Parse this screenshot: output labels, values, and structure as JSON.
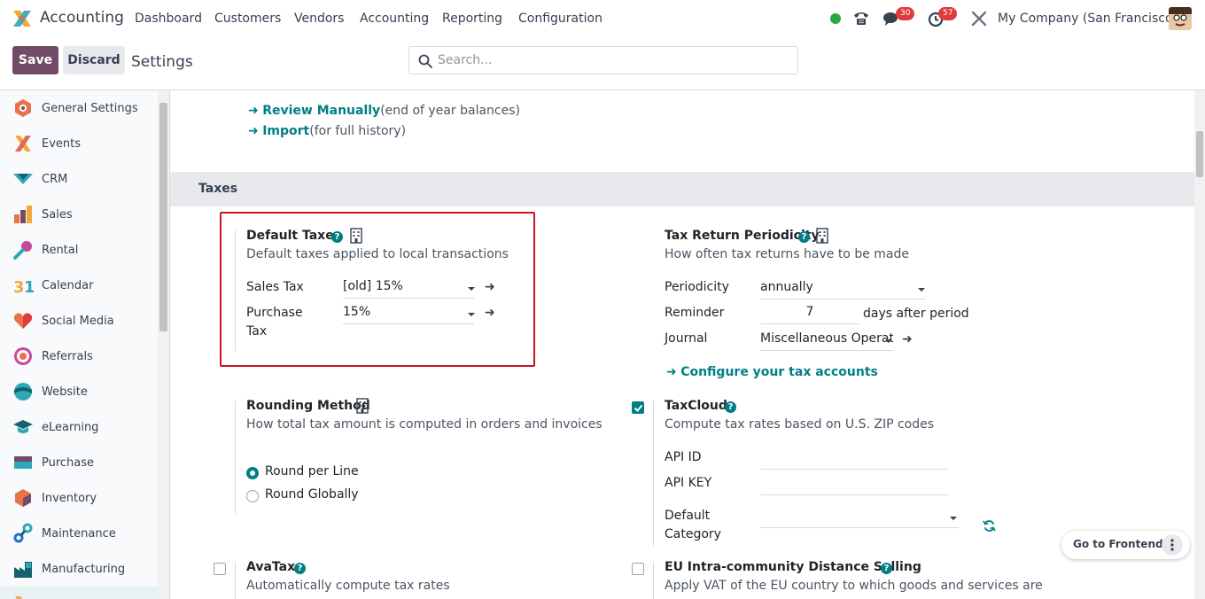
{
  "app": {
    "name": "Accounting"
  },
  "menu": [
    "Dashboard",
    "Customers",
    "Vendors",
    "Accounting",
    "Reporting",
    "Configuration"
  ],
  "systray": {
    "messages_count": "30",
    "activities_count": "57",
    "company": "My Company (San Francisco)",
    "status_color": "#28a745"
  },
  "controls": {
    "save": "Save",
    "discard": "Discard",
    "breadcrumb": "Settings",
    "search_placeholder": "Search..."
  },
  "sidebar": {
    "items": [
      {
        "label": "General Settings",
        "icon": "general-settings-icon"
      },
      {
        "label": "Events",
        "icon": "events-icon"
      },
      {
        "label": "CRM",
        "icon": "crm-icon"
      },
      {
        "label": "Sales",
        "icon": "sales-icon"
      },
      {
        "label": "Rental",
        "icon": "rental-icon"
      },
      {
        "label": "Calendar",
        "icon": "calendar-icon"
      },
      {
        "label": "Social Media",
        "icon": "social-media-icon"
      },
      {
        "label": "Referrals",
        "icon": "referrals-icon"
      },
      {
        "label": "Website",
        "icon": "website-icon"
      },
      {
        "label": "eLearning",
        "icon": "elearning-icon"
      },
      {
        "label": "Purchase",
        "icon": "purchase-icon"
      },
      {
        "label": "Inventory",
        "icon": "inventory-icon"
      },
      {
        "label": "Maintenance",
        "icon": "maintenance-icon"
      },
      {
        "label": "Manufacturing",
        "icon": "manufacturing-icon"
      }
    ]
  },
  "top_links": {
    "review_label": "Review Manually",
    "review_note": "(end of year balances)",
    "import_label": "Import",
    "import_note": "(for full history)"
  },
  "section": {
    "title": "Taxes"
  },
  "default_taxes": {
    "title": "Default Taxes",
    "desc": "Default taxes applied to local transactions",
    "sales_label": "Sales Tax",
    "sales_value": "[old] 15%",
    "purchase_label_1": "Purchase",
    "purchase_label_2": "Tax",
    "purchase_value": "15%"
  },
  "tax_return": {
    "title": "Tax Return Periodicity",
    "desc": "How often tax returns have to be made",
    "periodicity_label": "Periodicity",
    "periodicity_value": "annually",
    "reminder_label": "Reminder",
    "reminder_value": "7",
    "reminder_suffix": "days after period",
    "journal_label": "Journal",
    "journal_value": "Miscellaneous Operat",
    "configure_link": "Configure your tax accounts"
  },
  "rounding": {
    "title": "Rounding Method",
    "desc": "How total tax amount is computed in orders and invoices",
    "opt_line": "Round per Line",
    "opt_global": "Round Globally",
    "selected": "Round per Line"
  },
  "taxcloud": {
    "title": "TaxCloud",
    "desc": "Compute tax rates based on U.S. ZIP codes",
    "checked": true,
    "api_id_label": "API ID",
    "api_key_label": "API KEY",
    "default_cat_1": "Default",
    "default_cat_2": "Category"
  },
  "avatax": {
    "title": "AvaTax",
    "desc": "Automatically compute tax rates",
    "checked": false
  },
  "eu_distance": {
    "title": "EU Intra-community Distance Selling",
    "desc": "Apply VAT of the EU country to which goods and services are",
    "checked": false
  },
  "frontend": {
    "label": "Go to Frontend"
  },
  "colors": {
    "brand": "#714b67",
    "accent": "#017e84",
    "highlight": "#c9161e"
  }
}
